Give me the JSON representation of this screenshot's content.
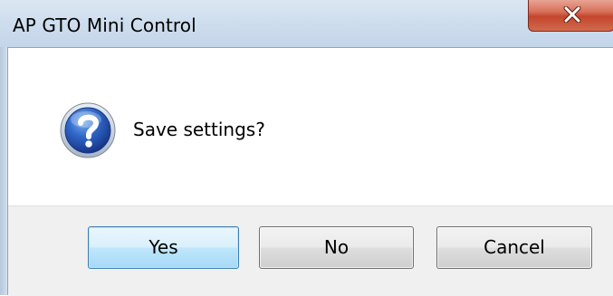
{
  "window": {
    "title": "AP GTO Mini Control"
  },
  "title_bar": {
    "close_icon": "close-x-icon"
  },
  "dialog": {
    "icon": "question-icon",
    "message": "Save settings?"
  },
  "buttons": {
    "yes_label": "Yes",
    "no_label": "No",
    "cancel_label": "Cancel",
    "default": "Yes"
  },
  "colors": {
    "close_button": "#c4462c",
    "question_icon": "#1f4fa3",
    "default_button_border": "#3c7fb1"
  }
}
